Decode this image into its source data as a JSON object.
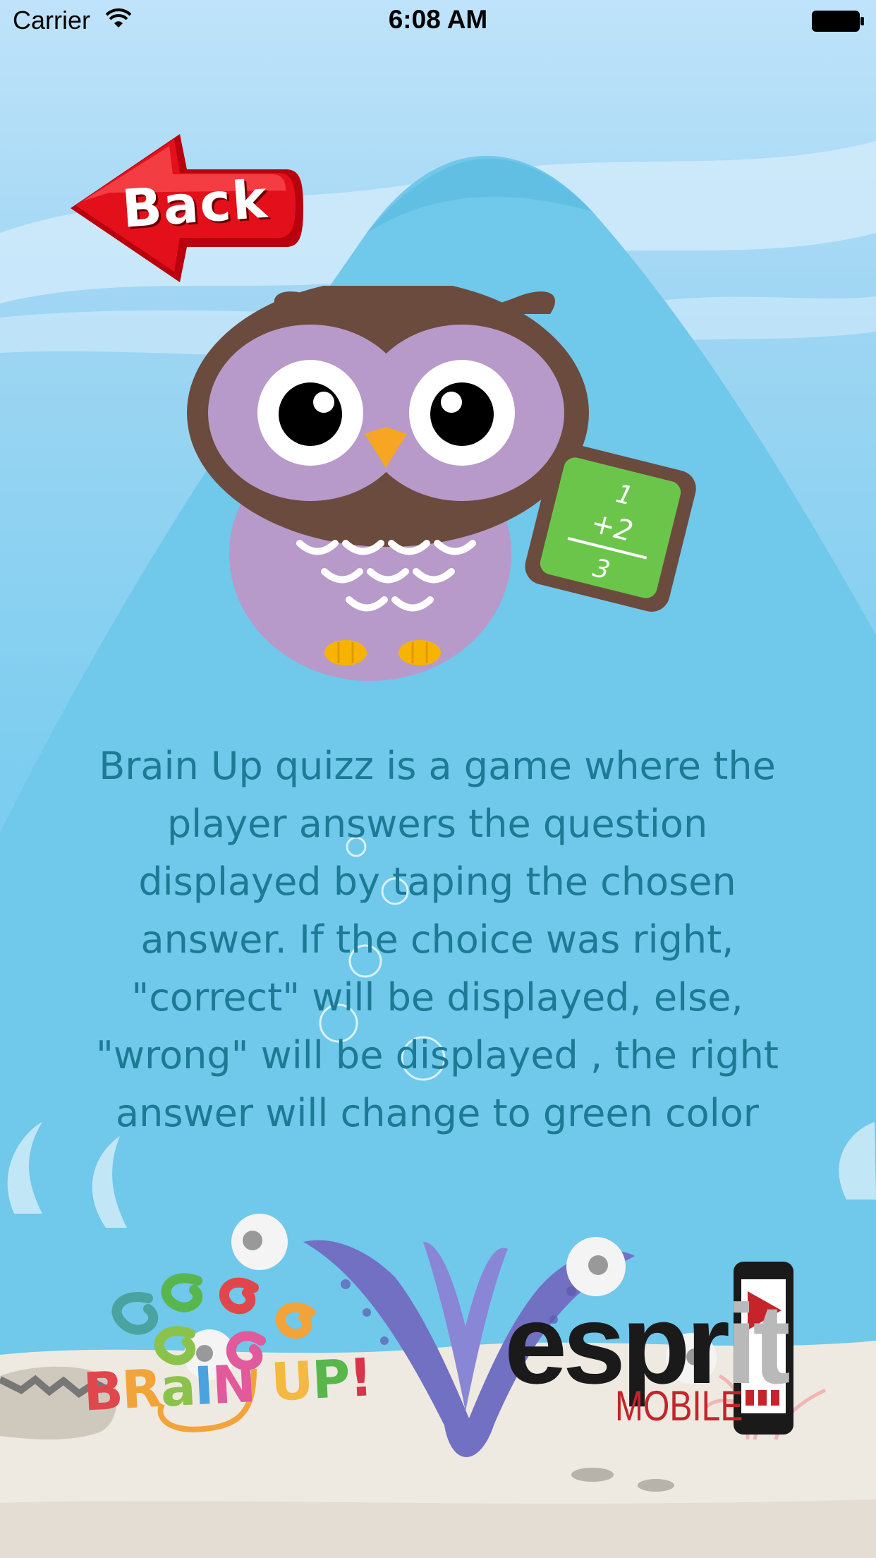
{
  "status_bar": {
    "carrier": "Carrier",
    "time": "6:08 AM"
  },
  "back_button": {
    "label": "Back"
  },
  "owl_card": {
    "line1": "1",
    "line2": "+2",
    "line3": "3"
  },
  "description": "Brain Up quizz is a game where the player answers the question displayed by taping the chosen answer. If the choice was right, \"correct\" will be displayed, else, \"wrong\" will be displayed , the right answer will change to green color",
  "brain_logo": {
    "letters": [
      "B",
      "R",
      "a",
      "I",
      "N",
      " ",
      "U",
      "P",
      "!"
    ],
    "colors": [
      "#e0474c",
      "#f2a43a",
      "#8bc34a",
      "#4aa3df",
      "#e05a9c",
      "",
      "#f5b942",
      "#58b64c",
      "#d9344a"
    ]
  },
  "esprit_logo": {
    "word_dark": "espr",
    "word_light": "it",
    "subtitle": "MOBILE"
  },
  "colors": {
    "sky_top": "#bfe3fa",
    "sea": "#78caee",
    "text": "#1d7a95",
    "back_red": "#d0121b",
    "owl_purple": "#b79ac9",
    "owl_brown": "#6b4b3e",
    "card_green": "#6cc54b"
  }
}
